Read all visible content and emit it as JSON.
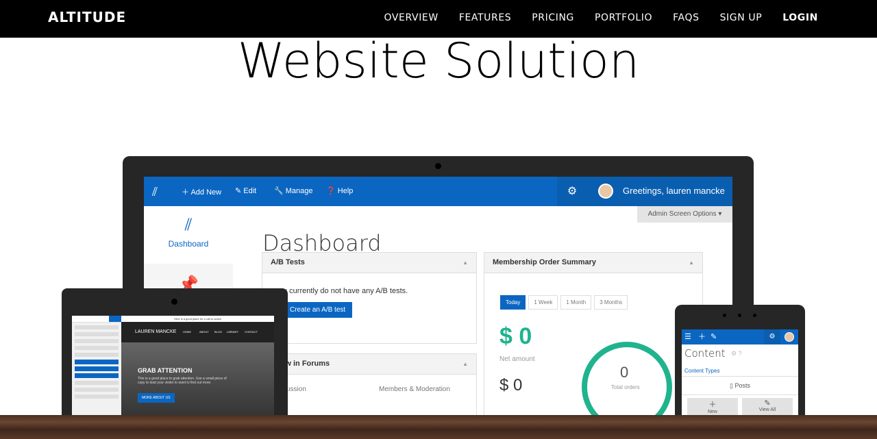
{
  "brand": {
    "logo": "ALTITUDE"
  },
  "nav": {
    "items": [
      "OVERVIEW",
      "FEATURES",
      "PRICING",
      "PORTFOLIO",
      "FAQS",
      "SIGN UP"
    ],
    "login": "LOGIN"
  },
  "hero": {
    "title": "Website Solution"
  },
  "laptop": {
    "adminbar": {
      "add_new": "Add New",
      "edit": "Edit",
      "manage": "Manage",
      "help": "Help",
      "greeting": "Greetings, lauren mancke"
    },
    "sidebar": {
      "dashboard": "Dashboard"
    },
    "screen_options": "Admin Screen Options",
    "page_title": "Dashboard",
    "ab_panel": {
      "title": "A/B Tests",
      "text": "u currently do not have any A/B tests.",
      "button": "Create an A/B test"
    },
    "forums_panel": {
      "title": "t Now in Forums",
      "col1": "cussion",
      "col2": "Members & Moderation"
    },
    "membership_panel": {
      "title": "Membership Order Summary",
      "tabs": [
        "Today",
        "1 Week",
        "1 Month",
        "3 Months"
      ],
      "net_value": "$ 0",
      "net_label": "Net amount",
      "second_value": "$ 0",
      "ring_value": "0",
      "ring_label": "Total orders"
    }
  },
  "tablet": {
    "header_text": "Here is a good place for a call to action",
    "nav": "LAUREN MANCKE",
    "nav_links": [
      "HOME",
      "ABOUT",
      "BLOG",
      "LIBRARY",
      "CONTACT"
    ],
    "heading": "GRAB ATTENTION",
    "body": "This is a good place to grab attention. Use a small piece of copy to lead your visitor to want to find out more.",
    "button": "MORE ABOUT US"
  },
  "phone": {
    "title": "Content",
    "content_types": "Content Types",
    "posts": "Posts",
    "new": "New",
    "view_all": "View All"
  },
  "colors": {
    "brand_blue": "#0b66c2",
    "accent_green": "#1fb38e",
    "topbar": "#000000"
  }
}
